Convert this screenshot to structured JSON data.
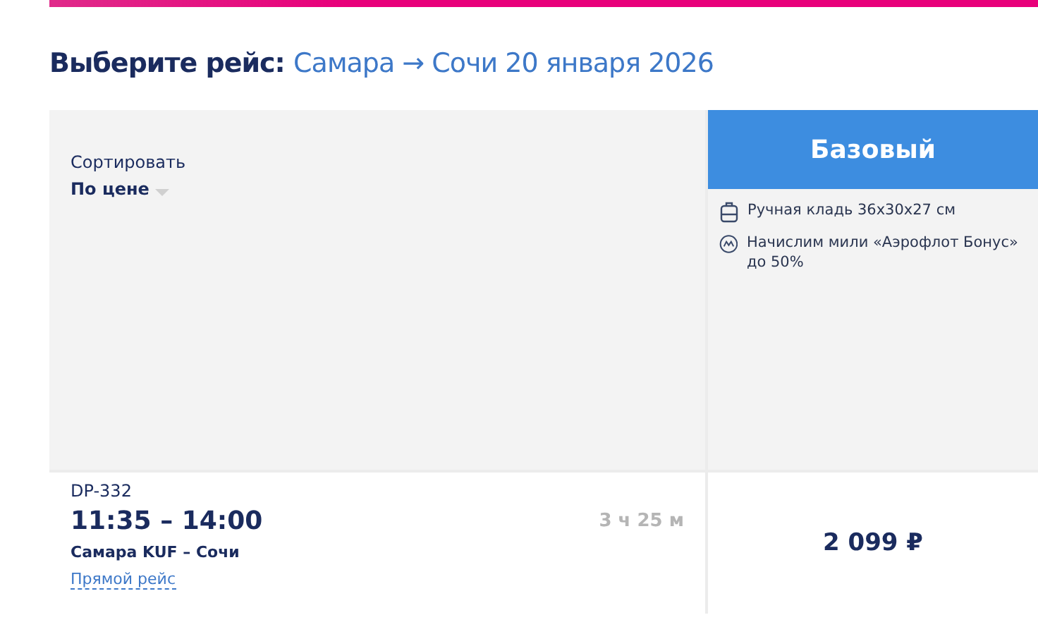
{
  "heading": {
    "label": "Выберите рейс:",
    "route": "Самара →  Сочи 20 января 2026"
  },
  "sort": {
    "label": "Сортировать",
    "value": "По цене"
  },
  "fare": {
    "name": "Базовый",
    "features": [
      {
        "kind": "baggage",
        "text": "Ручная кладь 36x30x27 см"
      },
      {
        "kind": "miles",
        "text": "Начислим мили «Аэрофлот Бонус» до 50%"
      }
    ]
  },
  "flights": [
    {
      "number": "DP-332",
      "times": "11:35 – 14:00",
      "duration": "3 ч 25 м",
      "route": "Самара KUF – Сочи",
      "type": "Прямой рейс",
      "price": "2 099 ₽"
    }
  ]
}
